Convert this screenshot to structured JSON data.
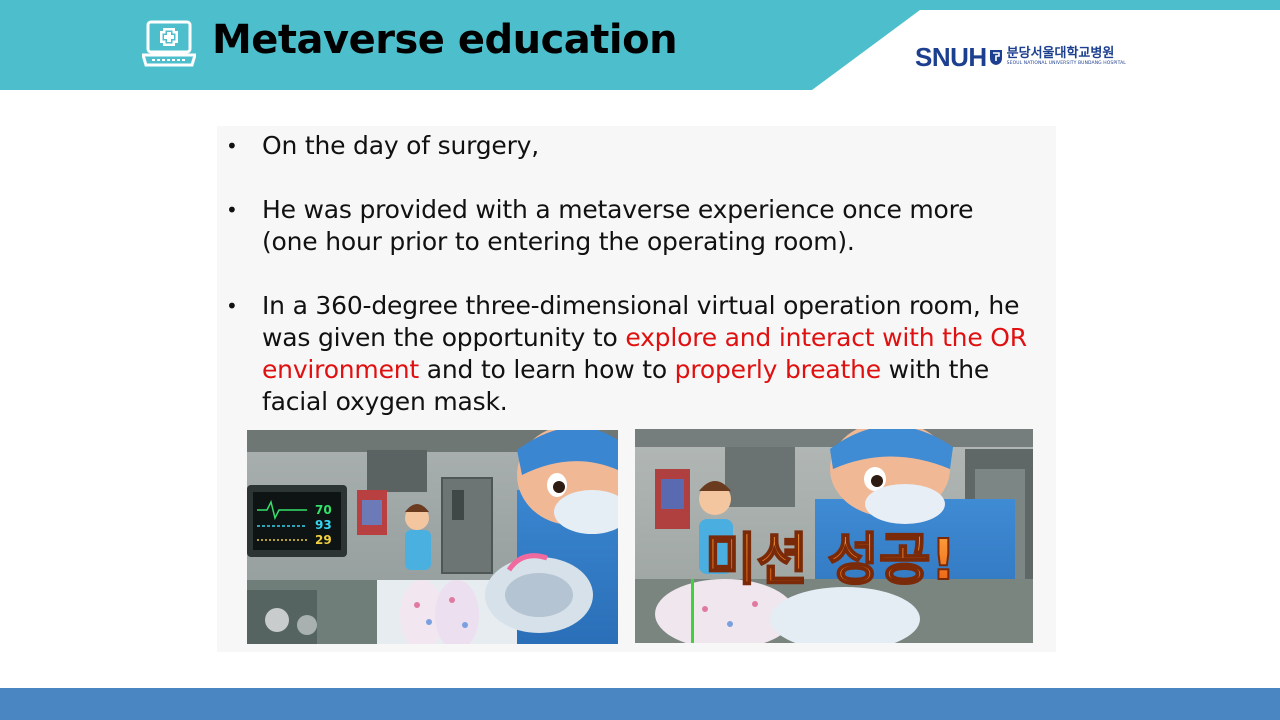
{
  "header": {
    "title": "Metaverse education",
    "icon": "laptop-medical-icon",
    "band_color": "#4dbfcc"
  },
  "logo": {
    "brand": "SNUH",
    "korean_name": "분당서울대학교병원",
    "english_name": "SEOUL NATIONAL UNIVERSITY BUNDANG HOSPITAL",
    "color": "#1d3f8f"
  },
  "content": {
    "bullets": [
      {
        "text": "On the day of surgery,"
      },
      {
        "text": "He was provided with a metaverse experience once more (one hour prior to entering the operating room)."
      },
      {
        "part1": "In a 360-degree three-dimensional virtual operation room, he was given the opportunity to ",
        "highlight1": "explore and interact with the OR environment",
        "part2": " and to learn how to ",
        "highlight2": "properly breathe",
        "part3": " with the facial oxygen mask."
      }
    ],
    "highlight_color": "#e01010"
  },
  "images": [
    {
      "monitor_values": [
        "70",
        "93",
        "29"
      ]
    },
    {
      "overlay_text": "미션 성공!"
    }
  ],
  "footer": {
    "band_color": "#4a87c2"
  }
}
